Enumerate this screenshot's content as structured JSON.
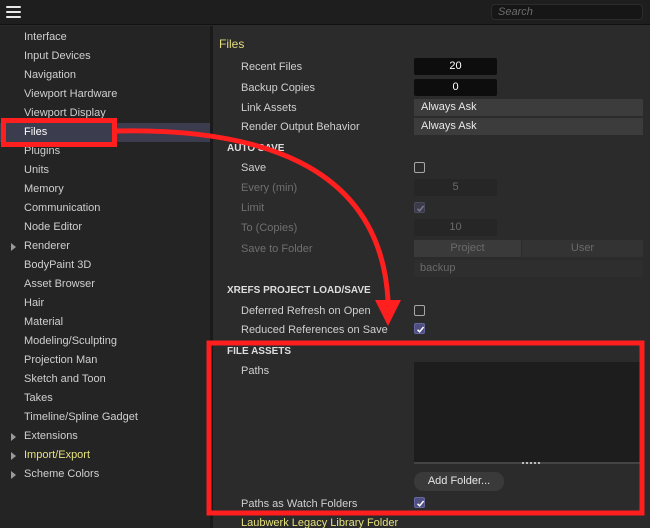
{
  "search": {
    "placeholder": "Search"
  },
  "sidebar": {
    "items": [
      {
        "label": "Interface",
        "expandable": false
      },
      {
        "label": "Input Devices",
        "expandable": false
      },
      {
        "label": "Navigation",
        "expandable": false
      },
      {
        "label": "Viewport Hardware",
        "expandable": false
      },
      {
        "label": "Viewport Display",
        "expandable": false
      },
      {
        "label": "Files",
        "expandable": false,
        "selected": true
      },
      {
        "label": "Plugins",
        "expandable": false
      },
      {
        "label": "Units",
        "expandable": false
      },
      {
        "label": "Memory",
        "expandable": false
      },
      {
        "label": "Communication",
        "expandable": false
      },
      {
        "label": "Node Editor",
        "expandable": false
      },
      {
        "label": "Renderer",
        "expandable": true
      },
      {
        "label": "BodyPaint 3D",
        "expandable": false
      },
      {
        "label": "Asset Browser",
        "expandable": false
      },
      {
        "label": "Hair",
        "expandable": false
      },
      {
        "label": "Material",
        "expandable": false
      },
      {
        "label": "Modeling/Sculpting",
        "expandable": false
      },
      {
        "label": "Projection Man",
        "expandable": false
      },
      {
        "label": "Sketch and Toon",
        "expandable": false
      },
      {
        "label": "Takes",
        "expandable": false
      },
      {
        "label": "Timeline/Spline Gadget",
        "expandable": false
      },
      {
        "label": "Extensions",
        "expandable": true
      },
      {
        "label": "Import/Export",
        "expandable": true,
        "highlight": true
      },
      {
        "label": "Scheme Colors",
        "expandable": true
      }
    ]
  },
  "files": {
    "title": "Files",
    "recent_files": {
      "label": "Recent Files",
      "value": "20"
    },
    "backup_copies": {
      "label": "Backup Copies",
      "value": "0"
    },
    "link_assets": {
      "label": "Link Assets",
      "value": "Always Ask"
    },
    "render_output": {
      "label": "Render Output Behavior",
      "value": "Always Ask"
    }
  },
  "autosave": {
    "heading": "AUTO SAVE",
    "save": {
      "label": "Save",
      "checked": false
    },
    "every": {
      "label": "Every (min)",
      "value": "5"
    },
    "limit": {
      "label": "Limit",
      "checked": true
    },
    "to_copies": {
      "label": "To (Copies)",
      "value": "10"
    },
    "save_to_folder": {
      "label": "Save to Folder",
      "options": [
        "Project",
        "User"
      ]
    },
    "folder_value": "backup"
  },
  "xrefs": {
    "heading": "XREFS PROJECT LOAD/SAVE",
    "deferred": {
      "label": "Deferred Refresh on Open",
      "checked": false
    },
    "reduced": {
      "label": "Reduced References on Save",
      "checked": true
    }
  },
  "file_assets": {
    "heading": "FILE ASSETS",
    "paths_label": "Paths",
    "add_folder": "Add Folder...",
    "watch_folders": {
      "label": "Paths as Watch Folders",
      "checked": true
    },
    "laubwerk": "Laubwerk Legacy Library Folder"
  },
  "colors": {
    "annotation_red": "#ff1f1f",
    "title_yellow": "#e3dd7e",
    "selection": "#3b3d4f",
    "checkbox_checked": "#4e4f80"
  }
}
